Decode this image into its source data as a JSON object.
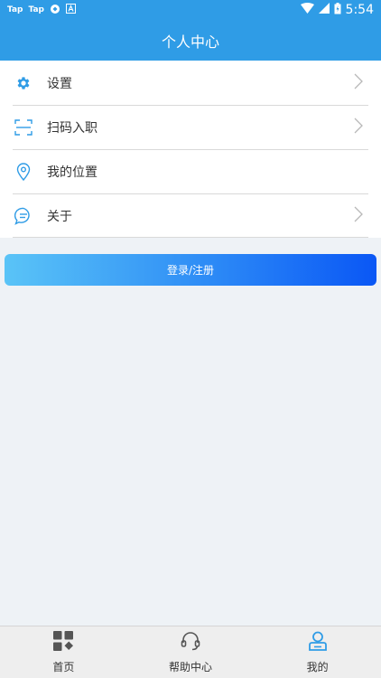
{
  "status_bar": {
    "left_items": [
      "Tap",
      "Tap"
    ],
    "time": "5:54"
  },
  "app_bar": {
    "title": "个人中心"
  },
  "menu": {
    "items": [
      {
        "label": "设置",
        "icon": "gear-icon",
        "has_chevron": true
      },
      {
        "label": "扫码入职",
        "icon": "scan-icon",
        "has_chevron": true
      },
      {
        "label": "我的位置",
        "icon": "location-pin-icon",
        "has_chevron": false
      },
      {
        "label": "关于",
        "icon": "chat-bubble-icon",
        "has_chevron": true
      }
    ]
  },
  "login_button": {
    "label": "登录/注册"
  },
  "tab_bar": {
    "tabs": [
      {
        "label": "首页",
        "icon": "home-grid-icon",
        "active": false
      },
      {
        "label": "帮助中心",
        "icon": "headset-icon",
        "active": false
      },
      {
        "label": "我的",
        "icon": "user-profile-icon",
        "active": true
      }
    ]
  },
  "colors": {
    "primary": "#2f9ce6",
    "icon_blue": "#2f9ce6",
    "background": "#eef2f6",
    "tab_active": "#2f9ce6",
    "tab_inactive": "#555555"
  }
}
